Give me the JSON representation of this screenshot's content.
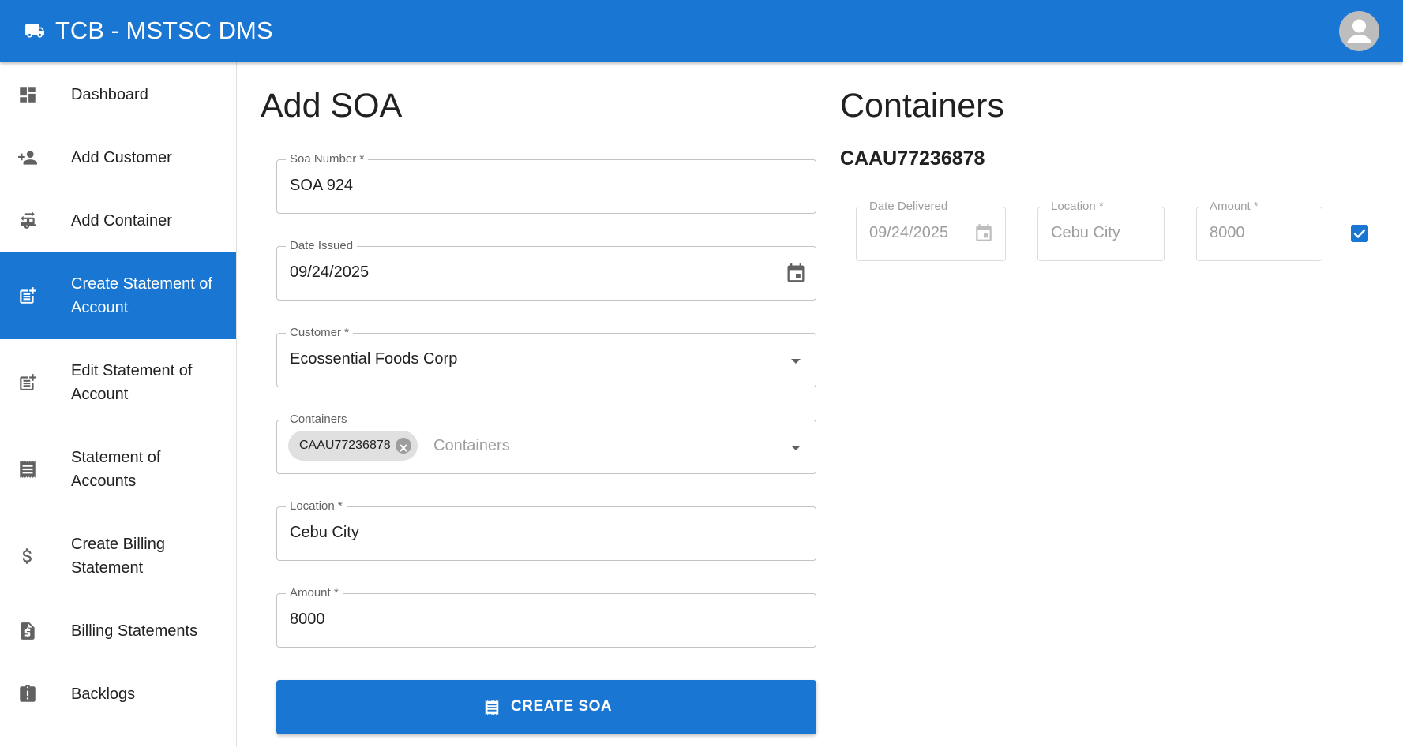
{
  "app": {
    "title": "TCB - MSTSC DMS",
    "icon": "truck-icon",
    "account_icon": "account-circle-icon",
    "brand_color": "#1976d2"
  },
  "sidebar": {
    "items": [
      {
        "label": "Dashboard",
        "icon": "dashboard-icon"
      },
      {
        "label": "Add Customer",
        "icon": "person-add-icon"
      },
      {
        "label": "Add Container",
        "icon": "rv-hookup-icon"
      },
      {
        "label": "Create Statement of Account",
        "icon": "post-add-icon",
        "active": true
      },
      {
        "label": "Edit Statement of Account",
        "icon": "post-add-icon"
      },
      {
        "label": "Statement of Accounts",
        "icon": "receipt-icon"
      },
      {
        "label": "Create Billing Statement",
        "icon": "dollar-icon"
      },
      {
        "label": "Billing Statements",
        "icon": "request-quote-icon"
      },
      {
        "label": "Backlogs",
        "icon": "assignment-late-icon"
      }
    ]
  },
  "form": {
    "title": "Add SOA",
    "soa_number": {
      "label": "Soa Number *",
      "value": "SOA 924"
    },
    "date_issued": {
      "label": "Date Issued",
      "value": "09/24/2025"
    },
    "customer": {
      "label": "Customer *",
      "value": "Ecossential Foods Corp"
    },
    "containers": {
      "label": "Containers",
      "chip": "CAAU77236878",
      "placeholder": "Containers"
    },
    "location": {
      "label": "Location *",
      "value": "Cebu City"
    },
    "amount": {
      "label": "Amount *",
      "value": "8000"
    },
    "submit_label": "CREATE SOA"
  },
  "containers_panel": {
    "title": "Containers",
    "items": [
      {
        "id": "CAAU77236878",
        "date_delivered": {
          "label": "Date Delivered",
          "value": "09/24/2025"
        },
        "location": {
          "label": "Location *",
          "value": "Cebu City"
        },
        "amount": {
          "label": "Amount *",
          "value": "8000"
        },
        "checked": true
      }
    ]
  }
}
